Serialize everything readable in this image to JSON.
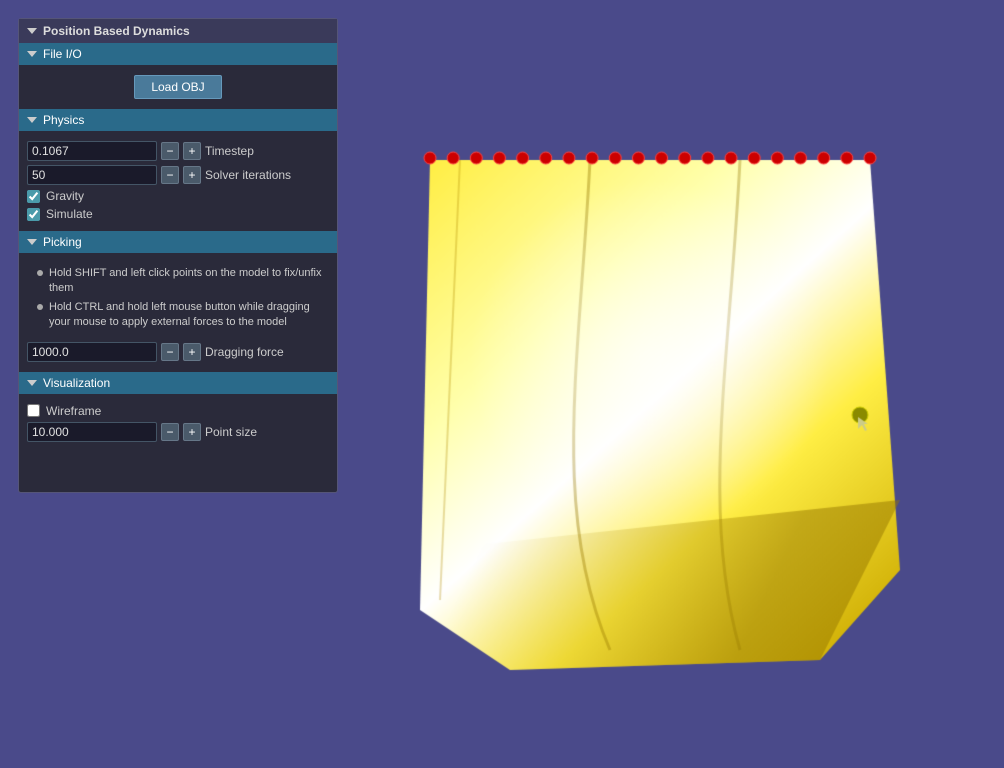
{
  "panel": {
    "title": "Position Based Dynamics",
    "file_io": {
      "label": "File I/O",
      "load_obj_label": "Load OBJ"
    },
    "physics": {
      "label": "Physics",
      "timestep_value": "0.1067",
      "timestep_label": "Timestep",
      "solver_iterations_value": "50",
      "solver_iterations_label": "Solver iterations",
      "gravity_label": "Gravity",
      "gravity_checked": true,
      "simulate_label": "Simulate",
      "simulate_checked": true
    },
    "picking": {
      "label": "Picking",
      "instructions": [
        "Hold SHIFT and left click points on the model to fix/unfix them",
        "Hold CTRL and hold left mouse button while dragging your mouse to apply external forces to the model"
      ],
      "dragging_force_value": "1000.0",
      "dragging_force_label": "Dragging force"
    },
    "visualization": {
      "label": "Visualization",
      "wireframe_label": "Wireframe",
      "wireframe_checked": false,
      "point_size_value": "10.000",
      "point_size_label": "Point size"
    }
  },
  "icons": {
    "triangle_down": "▼",
    "minus": "−",
    "plus": "+"
  },
  "viewport": {
    "background_color": "#4a4a8a"
  }
}
